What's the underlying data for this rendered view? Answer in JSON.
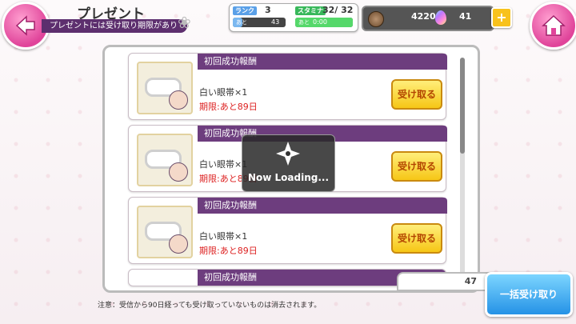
{
  "header": {
    "title": "プレゼント",
    "subtitle": "プレゼントには受け取り期限があり"
  },
  "status": {
    "rank_label": "ランク",
    "rank_value": "3",
    "rank_next_label": "あと",
    "rank_exp_remaining": "43",
    "stamina_label": "スタミナ",
    "stamina_value": "32/ 32",
    "stamina_next_label": "あと",
    "stamina_time": "0:00"
  },
  "currency": {
    "coins": "4220",
    "gems": "41",
    "plus_label": "+"
  },
  "gifts": [
    {
      "title": "初回成功報酬",
      "item": "白い眼帯×1",
      "limit": "期限:あと89日",
      "button": "受け取る"
    },
    {
      "title": "初回成功報酬",
      "item": "白い眼帯×1",
      "limit": "期限:あと89日",
      "button": "受け取る"
    },
    {
      "title": "初回成功報酬",
      "item": "白い眼帯×1",
      "limit": "期限:あと89日",
      "button": "受け取る"
    },
    {
      "title": "初回成功報酬"
    }
  ],
  "loading": {
    "text": "Now Loading..."
  },
  "count": "47",
  "notice": "注意：受信から90日経っても受け取っていないものは消去されます。",
  "bulk_button": "一括受け取り"
}
